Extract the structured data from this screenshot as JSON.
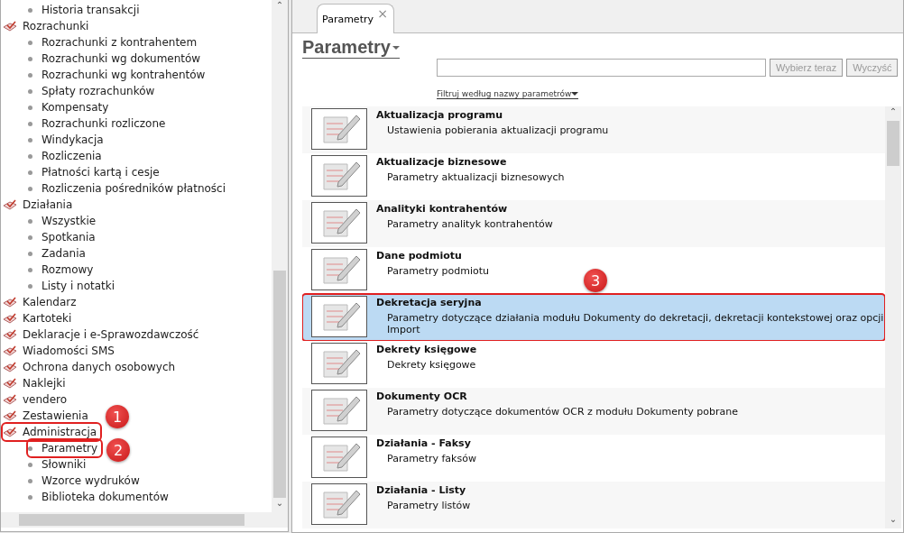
{
  "tree": [
    {
      "children": [
        {
          "label": "Historia transakcji"
        }
      ]
    },
    {
      "label": "Rozrachunki",
      "children": [
        {
          "label": "Rozrachunki z kontrahentem"
        },
        {
          "label": "Rozrachunki wg dokumentów"
        },
        {
          "label": "Rozrachunki wg kontrahentów"
        },
        {
          "label": "Spłaty rozrachunków"
        },
        {
          "label": "Kompensaty"
        },
        {
          "label": "Rozrachunki rozliczone"
        },
        {
          "label": "Windykacja"
        },
        {
          "label": "Rozliczenia"
        },
        {
          "label": "Płatności kartą i cesje"
        },
        {
          "label": "Rozliczenia pośredników płatności"
        }
      ]
    },
    {
      "label": "Działania",
      "children": [
        {
          "label": "Wszystkie"
        },
        {
          "label": "Spotkania"
        },
        {
          "label": "Zadania"
        },
        {
          "label": "Rozmowy"
        },
        {
          "label": "Listy i notatki"
        }
      ]
    },
    {
      "label": "Kalendarz"
    },
    {
      "label": "Kartoteki"
    },
    {
      "label": "Deklaracje i e-Sprawozdawczość"
    },
    {
      "label": "Wiadomości SMS"
    },
    {
      "label": "Ochrona danych osobowych"
    },
    {
      "label": "Naklejki"
    },
    {
      "label": "vendero"
    },
    {
      "label": "Zestawienia"
    },
    {
      "label": "Administracja",
      "callout": "1",
      "children": [
        {
          "label": "Parametry",
          "callout": "2"
        },
        {
          "label": "Słowniki"
        },
        {
          "label": "Wzorce wydruków"
        },
        {
          "label": "Biblioteka dokumentów"
        }
      ]
    }
  ],
  "tabs": [
    {
      "label": "Parametry",
      "selected": true,
      "close": "×"
    }
  ],
  "heading": "Parametry",
  "scroll_arrows": {
    "up": "⌃",
    "down": "⌄"
  },
  "search": {
    "buttons": [
      "Wybierz teraz",
      "Wyczyść"
    ],
    "filter": "Filtruj według nazwy parametrów"
  },
  "parameters": [
    {
      "title": "Aktualizacja programu",
      "description": "Ustawienia pobierania aktualizacji programu",
      "selected": false
    },
    {
      "title": "Aktualizacje biznesowe",
      "description": "Parametry aktualizacji biznesowych",
      "selected": false
    },
    {
      "title": "Analityki kontrahentów",
      "description": "Parametry analityk kontrahentów",
      "selected": false
    },
    {
      "title": "Dane podmiotu",
      "description": "Parametry podmiotu",
      "selected": false
    },
    {
      "title": "Dekretacja seryjna",
      "description": "Parametry dotyczące działania modułu Dokumenty do dekretacji, dekretacji kontekstowej oraz opcji Import",
      "selected": true,
      "callout": "3"
    },
    {
      "title": "Dekrety księgowe",
      "description": "Dekrety księgowe",
      "selected": false
    },
    {
      "title": "Dokumenty OCR",
      "description": "Parametry dotyczące dokumentów OCR z modułu Dokumenty pobrane",
      "selected": false
    },
    {
      "title": "Działania - Faksy",
      "description": "Parametry faksów",
      "selected": false
    },
    {
      "title": "Działania - Listy",
      "description": "Parametry listów",
      "selected": false
    }
  ]
}
